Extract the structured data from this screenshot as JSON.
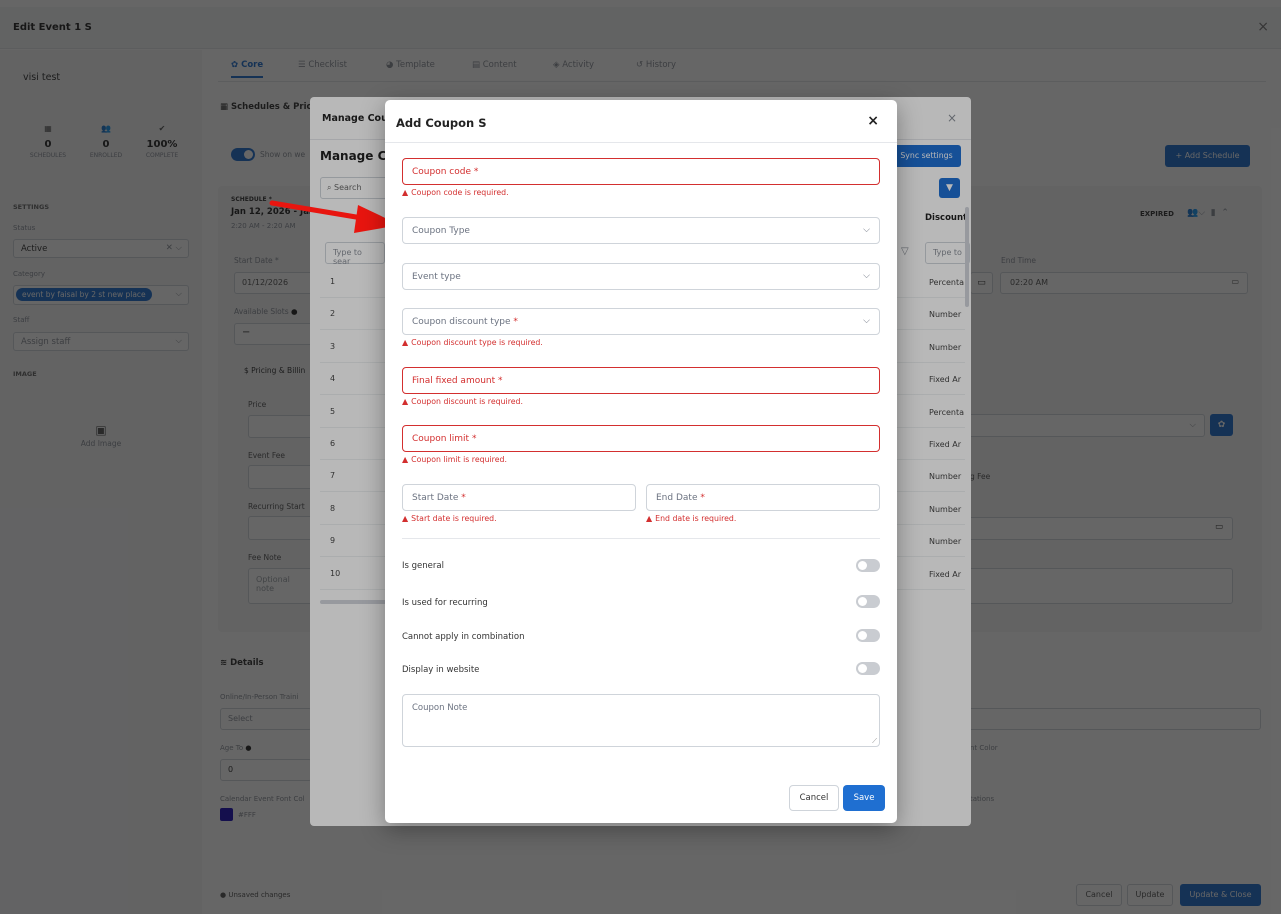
{
  "header": {
    "title": "Edit Event 1 S",
    "close": "×"
  },
  "sidebar": {
    "name": "visi test",
    "stats": [
      {
        "icon": "▦",
        "value": "0",
        "label": "SCHEDULES"
      },
      {
        "icon": "👥",
        "value": "0",
        "label": "ENROLLED"
      },
      {
        "icon": "✔",
        "value": "100%",
        "label": "COMPLETE"
      }
    ],
    "settings_label": "SETTINGS",
    "status_label": "Status",
    "status_value": "Active",
    "category_label": "Category",
    "category_value": "event by faisal by 2 st new place",
    "staff_label": "Staff",
    "staff_placeholder": "Assign staff",
    "image_label": "IMAGE",
    "add_image": "Add Image"
  },
  "tabs": [
    "Core",
    "Checklist",
    "Template",
    "Content",
    "Activity",
    "History"
  ],
  "tab_icons": [
    "✿",
    "☰",
    "◕",
    "▤",
    "◈",
    "↺"
  ],
  "bg": {
    "schedules_title": "Schedules & Pric",
    "show_on_web": "Show on we",
    "sync_settings": "Sync settings",
    "add_schedule": "+ Add Schedule",
    "schedule_label": "SCHEDULE *",
    "schedule_date": "Jan 12, 2026 - Jan",
    "schedule_time": "2:20 AM - 2:20 AM",
    "expired": "EXPIRED",
    "start_date_label": "Start Date *",
    "start_date_value": "01/12/2026",
    "end_time_label": "End Time",
    "end_time_value": "02:20 AM",
    "available_slots": "Available Slots",
    "pricing": "Pricing & Billin",
    "price": "Price",
    "event_fee": "Event Fee",
    "recurring_start": "Recurring Start",
    "fee_note": "Fee Note",
    "fee_note_placeholder": "Optional note",
    "ng_fee": "g Fee",
    "details": "Details",
    "online_label": "Online/In-Person Traini",
    "online_value": "Select",
    "age_to_label": "Age To",
    "age_to_value": "0",
    "cal_font_label": "Calendar Event Font Col",
    "cal_font_value": "#FFF",
    "nt_color": "nt Color",
    "tations": "tations",
    "unsaved": "Unsaved changes",
    "cancel": "Cancel",
    "update": "Update",
    "update_close": "Update & Close"
  },
  "manage": {
    "title": "Manage Cou",
    "subtitle": "Manage Co",
    "search": "Search",
    "type_to_search": "Type to sear",
    "type_to": "Type to",
    "discount_header": "Discount",
    "rows": [
      "1",
      "2",
      "3",
      "4",
      "5",
      "6",
      "7",
      "8",
      "9",
      "10"
    ],
    "discounts": [
      "Percenta",
      "Number",
      "Number",
      "Fixed Ar",
      "Percenta",
      "Fixed Ar",
      "Number",
      "Number",
      "Number",
      "Fixed Ar"
    ]
  },
  "modal": {
    "title": "Add Coupon S",
    "close": "×",
    "coupon_code": "Coupon code",
    "coupon_code_err": "Coupon code is required.",
    "coupon_type": "Coupon Type",
    "event_type": "Event type",
    "discount_type": "Coupon discount type",
    "discount_type_err": "Coupon discount type is required.",
    "final_amount": "Final fixed amount",
    "final_amount_err": "Coupon discount is required.",
    "coupon_limit": "Coupon limit",
    "coupon_limit_err": "Coupon limit is required.",
    "start_date": "Start Date",
    "start_date_err": "Start date is required.",
    "end_date": "End Date",
    "end_date_err": "End date is required.",
    "toggles": [
      "Is general",
      "Is used for recurring",
      "Cannot apply in combination",
      "Display in website"
    ],
    "note_placeholder": "Coupon Note",
    "cancel": "Cancel",
    "save": "Save"
  }
}
